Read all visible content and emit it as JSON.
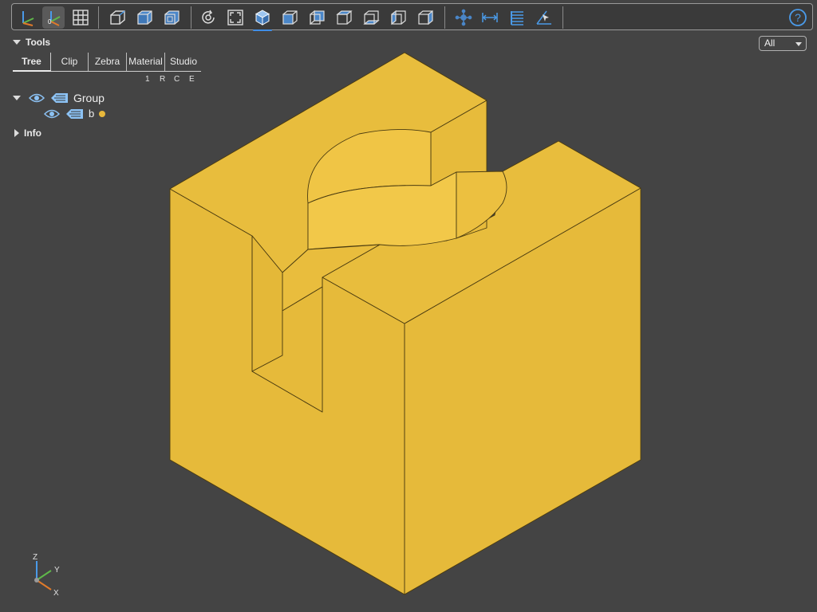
{
  "toolbar": {
    "buttons": [
      {
        "name": "axes-toggle",
        "icon": "axes-icon"
      },
      {
        "name": "axes-origin-toggle",
        "icon": "axes-origin-icon",
        "active": true
      },
      {
        "name": "grid-toggle",
        "icon": "grid-icon"
      },
      {
        "name": "perspective-toggle",
        "icon": "perspective-icon"
      },
      {
        "name": "transparent-toggle",
        "icon": "transparent-icon"
      },
      {
        "name": "blackedges-toggle",
        "icon": "black-edges-icon"
      },
      {
        "name": "reset-view",
        "icon": "reset-icon"
      },
      {
        "name": "zoom-fit",
        "icon": "fit-icon"
      },
      {
        "name": "view-iso",
        "icon": "iso-view-icon",
        "selected": true
      },
      {
        "name": "view-front",
        "icon": "front-view-icon"
      },
      {
        "name": "view-rear",
        "icon": "rear-view-icon"
      },
      {
        "name": "view-top",
        "icon": "top-view-icon"
      },
      {
        "name": "view-bottom",
        "icon": "bottom-view-icon"
      },
      {
        "name": "view-left",
        "icon": "left-view-icon"
      },
      {
        "name": "view-right",
        "icon": "right-view-icon"
      },
      {
        "name": "explode-tool",
        "icon": "explode-icon"
      },
      {
        "name": "distance-tool",
        "icon": "distance-icon"
      },
      {
        "name": "properties-tool",
        "icon": "properties-icon"
      },
      {
        "name": "angle-tool",
        "icon": "angle-icon"
      },
      {
        "name": "help",
        "icon": "help-icon"
      }
    ]
  },
  "tools_panel": {
    "title": "Tools",
    "tabs": [
      "Tree",
      "Clip",
      "Zebra",
      "Material",
      "Studio"
    ],
    "active_tab": "Tree",
    "columns": {
      "c1": "1",
      "c2": "R",
      "c3": "C",
      "c4": "E"
    }
  },
  "tree": {
    "group_label": "Group",
    "child_label": "b",
    "child_color": "#e8b83b"
  },
  "info_panel": {
    "title": "Info"
  },
  "view_select": {
    "value": "All"
  },
  "axes": {
    "z": "Z",
    "y": "Y",
    "x": "X"
  },
  "colors": {
    "background": "#444444",
    "model_face": "#e8b83b",
    "accent": "#3f8ee8"
  }
}
